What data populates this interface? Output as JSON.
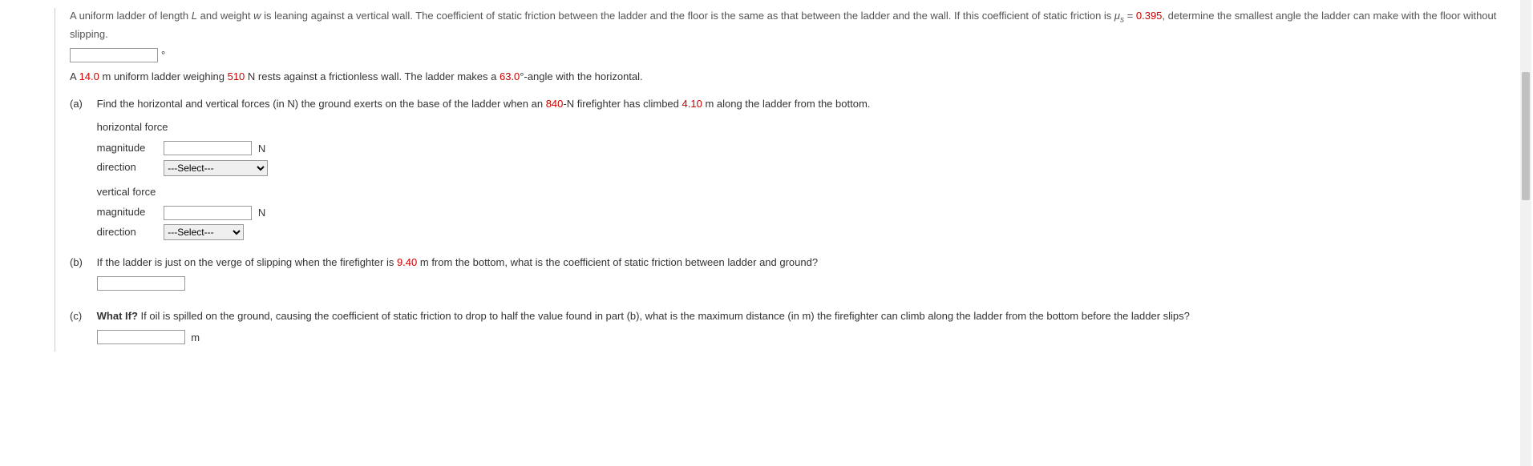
{
  "q1": {
    "text_pre": "A uniform ladder of length ",
    "L": "L",
    "text_mid1": " and weight ",
    "w": "w",
    "text_mid2": " is leaning against a vertical wall. The coefficient of static friction between the ladder and the floor is the same as that between the ladder and the wall. If this coefficient of static friction is ",
    "mu": "μ",
    "mu_sub": "s",
    "eq": " = ",
    "mu_val": "0.395",
    "text_post": ", determine the smallest angle the ladder can make with the floor without slipping.",
    "answer_unit": "°"
  },
  "q2": {
    "intro_p1": "A ",
    "len": "14.0",
    "intro_p2": " m uniform ladder weighing ",
    "weight": "510",
    "intro_p3": " N rests against a frictionless wall. The ladder makes a ",
    "angle": "63.0",
    "intro_p4": "°-angle with the horizontal."
  },
  "parts": {
    "a": {
      "label": "(a)",
      "text_p1": "Find the horizontal and vertical forces (in N) the ground exerts on the base of the ladder when an ",
      "ff_weight": "840",
      "text_p2": "-N firefighter has climbed ",
      "climb": "4.10",
      "text_p3": " m along the ladder from the bottom.",
      "horiz_label": "horizontal force",
      "vert_label": "vertical force",
      "magnitude": "magnitude",
      "direction": "direction",
      "unit": "N",
      "select_placeholder": "---Select---"
    },
    "b": {
      "label": "(b)",
      "text_p1": "If the ladder is just on the verge of slipping when the firefighter is ",
      "dist": "9.40",
      "text_p2": " m from the bottom, what is the coefficient of static friction between ladder and ground?"
    },
    "c": {
      "label": "(c)",
      "whatif": "What If?",
      "text": " If oil is spilled on the ground, causing the coefficient of static friction to drop to half the value found in part (b), what is the maximum distance (in m) the firefighter can climb along the ladder from the bottom before the ladder slips?",
      "unit": "m"
    }
  }
}
